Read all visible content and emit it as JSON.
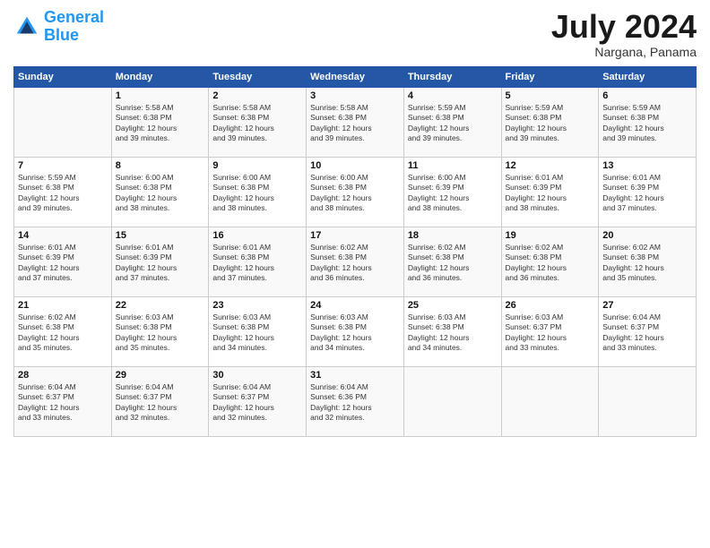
{
  "header": {
    "logo_line1": "General",
    "logo_line2": "Blue",
    "month_title": "July 2024",
    "subtitle": "Nargana, Panama"
  },
  "days_of_week": [
    "Sunday",
    "Monday",
    "Tuesday",
    "Wednesday",
    "Thursday",
    "Friday",
    "Saturday"
  ],
  "weeks": [
    [
      {
        "day": "",
        "info": ""
      },
      {
        "day": "1",
        "info": "Sunrise: 5:58 AM\nSunset: 6:38 PM\nDaylight: 12 hours\nand 39 minutes."
      },
      {
        "day": "2",
        "info": "Sunrise: 5:58 AM\nSunset: 6:38 PM\nDaylight: 12 hours\nand 39 minutes."
      },
      {
        "day": "3",
        "info": "Sunrise: 5:58 AM\nSunset: 6:38 PM\nDaylight: 12 hours\nand 39 minutes."
      },
      {
        "day": "4",
        "info": "Sunrise: 5:59 AM\nSunset: 6:38 PM\nDaylight: 12 hours\nand 39 minutes."
      },
      {
        "day": "5",
        "info": "Sunrise: 5:59 AM\nSunset: 6:38 PM\nDaylight: 12 hours\nand 39 minutes."
      },
      {
        "day": "6",
        "info": "Sunrise: 5:59 AM\nSunset: 6:38 PM\nDaylight: 12 hours\nand 39 minutes."
      }
    ],
    [
      {
        "day": "7",
        "info": "Sunrise: 5:59 AM\nSunset: 6:38 PM\nDaylight: 12 hours\nand 39 minutes."
      },
      {
        "day": "8",
        "info": "Sunrise: 6:00 AM\nSunset: 6:38 PM\nDaylight: 12 hours\nand 38 minutes."
      },
      {
        "day": "9",
        "info": "Sunrise: 6:00 AM\nSunset: 6:38 PM\nDaylight: 12 hours\nand 38 minutes."
      },
      {
        "day": "10",
        "info": "Sunrise: 6:00 AM\nSunset: 6:38 PM\nDaylight: 12 hours\nand 38 minutes."
      },
      {
        "day": "11",
        "info": "Sunrise: 6:00 AM\nSunset: 6:39 PM\nDaylight: 12 hours\nand 38 minutes."
      },
      {
        "day": "12",
        "info": "Sunrise: 6:01 AM\nSunset: 6:39 PM\nDaylight: 12 hours\nand 38 minutes."
      },
      {
        "day": "13",
        "info": "Sunrise: 6:01 AM\nSunset: 6:39 PM\nDaylight: 12 hours\nand 37 minutes."
      }
    ],
    [
      {
        "day": "14",
        "info": "Sunrise: 6:01 AM\nSunset: 6:39 PM\nDaylight: 12 hours\nand 37 minutes."
      },
      {
        "day": "15",
        "info": "Sunrise: 6:01 AM\nSunset: 6:39 PM\nDaylight: 12 hours\nand 37 minutes."
      },
      {
        "day": "16",
        "info": "Sunrise: 6:01 AM\nSunset: 6:38 PM\nDaylight: 12 hours\nand 37 minutes."
      },
      {
        "day": "17",
        "info": "Sunrise: 6:02 AM\nSunset: 6:38 PM\nDaylight: 12 hours\nand 36 minutes."
      },
      {
        "day": "18",
        "info": "Sunrise: 6:02 AM\nSunset: 6:38 PM\nDaylight: 12 hours\nand 36 minutes."
      },
      {
        "day": "19",
        "info": "Sunrise: 6:02 AM\nSunset: 6:38 PM\nDaylight: 12 hours\nand 36 minutes."
      },
      {
        "day": "20",
        "info": "Sunrise: 6:02 AM\nSunset: 6:38 PM\nDaylight: 12 hours\nand 35 minutes."
      }
    ],
    [
      {
        "day": "21",
        "info": "Sunrise: 6:02 AM\nSunset: 6:38 PM\nDaylight: 12 hours\nand 35 minutes."
      },
      {
        "day": "22",
        "info": "Sunrise: 6:03 AM\nSunset: 6:38 PM\nDaylight: 12 hours\nand 35 minutes."
      },
      {
        "day": "23",
        "info": "Sunrise: 6:03 AM\nSunset: 6:38 PM\nDaylight: 12 hours\nand 34 minutes."
      },
      {
        "day": "24",
        "info": "Sunrise: 6:03 AM\nSunset: 6:38 PM\nDaylight: 12 hours\nand 34 minutes."
      },
      {
        "day": "25",
        "info": "Sunrise: 6:03 AM\nSunset: 6:38 PM\nDaylight: 12 hours\nand 34 minutes."
      },
      {
        "day": "26",
        "info": "Sunrise: 6:03 AM\nSunset: 6:37 PM\nDaylight: 12 hours\nand 33 minutes."
      },
      {
        "day": "27",
        "info": "Sunrise: 6:04 AM\nSunset: 6:37 PM\nDaylight: 12 hours\nand 33 minutes."
      }
    ],
    [
      {
        "day": "28",
        "info": "Sunrise: 6:04 AM\nSunset: 6:37 PM\nDaylight: 12 hours\nand 33 minutes."
      },
      {
        "day": "29",
        "info": "Sunrise: 6:04 AM\nSunset: 6:37 PM\nDaylight: 12 hours\nand 32 minutes."
      },
      {
        "day": "30",
        "info": "Sunrise: 6:04 AM\nSunset: 6:37 PM\nDaylight: 12 hours\nand 32 minutes."
      },
      {
        "day": "31",
        "info": "Sunrise: 6:04 AM\nSunset: 6:36 PM\nDaylight: 12 hours\nand 32 minutes."
      },
      {
        "day": "",
        "info": ""
      },
      {
        "day": "",
        "info": ""
      },
      {
        "day": "",
        "info": ""
      }
    ]
  ]
}
